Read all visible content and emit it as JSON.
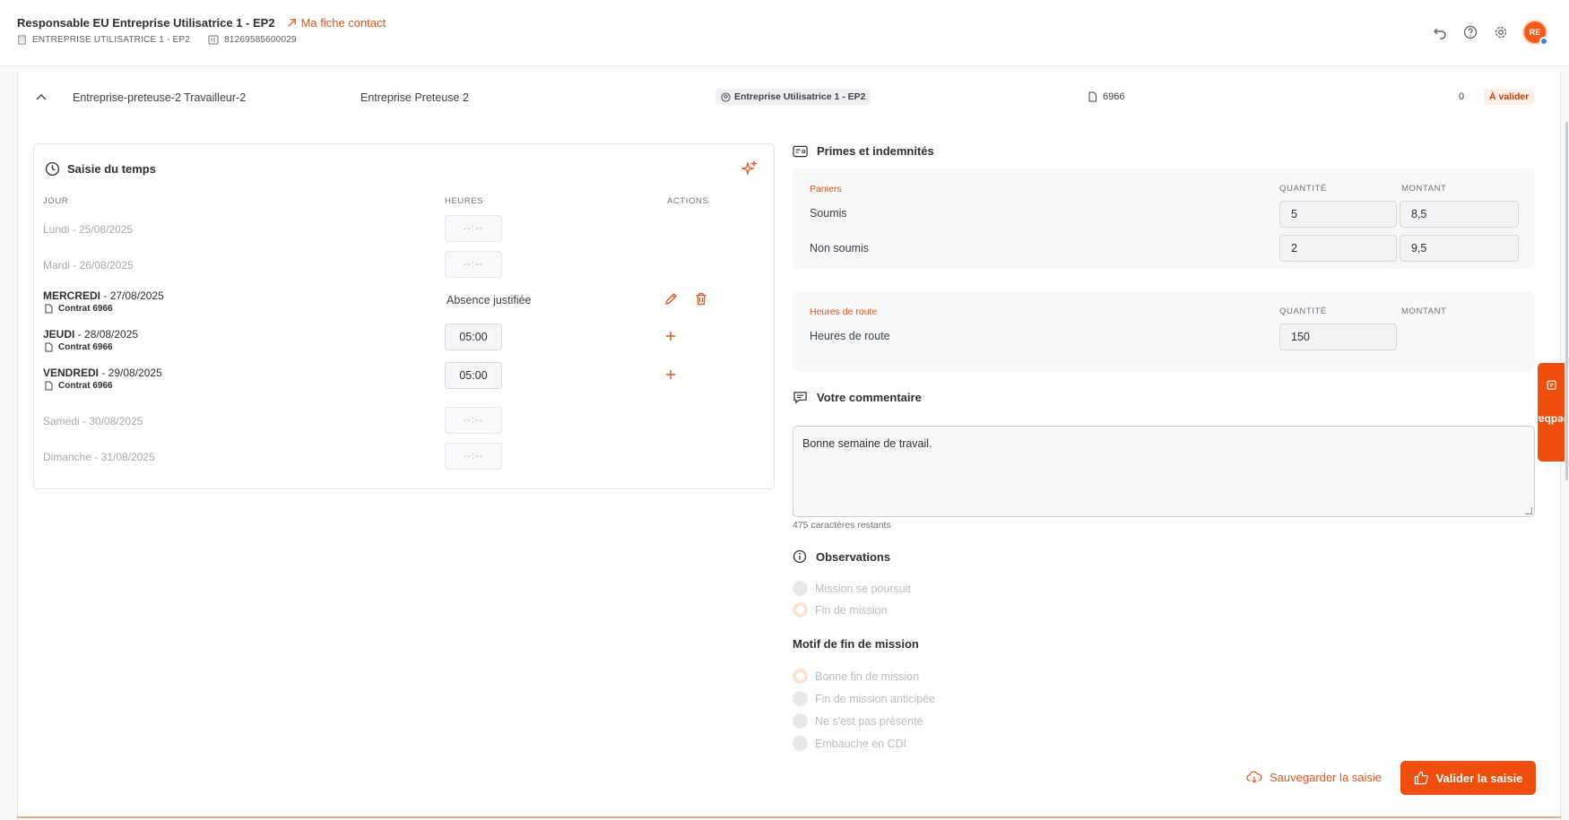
{
  "header": {
    "title": "Responsable EU Entreprise Utilisatrice 1 - EP2",
    "contact_link": "Ma fiche contact",
    "company": "ENTREPRISE UTILISATRICE 1 - EP2",
    "siret": "81269585600029",
    "avatar_initials": "RE"
  },
  "row": {
    "worker": "Entreprise-preteuse-2 Travailleur-2",
    "lender": "Entreprise Preteuse 2",
    "client_badge": "Entreprise Utilisatrice 1 - EP2",
    "contract": "6966",
    "count": "0",
    "status": "À valider"
  },
  "time": {
    "title": "Saisie du temps",
    "col_day": "JOUR",
    "col_hours": "HEURES",
    "col_actions": "ACTIONS",
    "empty_hours": "--:--",
    "days": [
      {
        "name": "Lundi",
        "date": "- 25/08/2025"
      },
      {
        "name": "Mardi",
        "date": "- 26/08/2025"
      },
      {
        "name": "MERCREDI",
        "date": "- 27/08/2025",
        "contract": "Contrat 6966",
        "absence": "Absence justifiée"
      },
      {
        "name": "JEUDI",
        "date": "- 28/08/2025",
        "contract": "Contrat 6966",
        "hours": "05:00"
      },
      {
        "name": "VENDREDI",
        "date": "- 29/08/2025",
        "contract": "Contrat 6966",
        "hours": "05:00"
      },
      {
        "name": "Samedi",
        "date": "- 30/08/2025"
      },
      {
        "name": "Dimanche",
        "date": "- 31/08/2025"
      }
    ]
  },
  "primes": {
    "title": "Primes et indemnités",
    "col_qty": "QUANTITÉ",
    "col_amount": "MONTANT",
    "paniers": {
      "category": "Paniers",
      "rows": [
        {
          "label": "Soumis",
          "qty": "5",
          "amount": "8,5"
        },
        {
          "label": "Non soumis",
          "qty": "2",
          "amount": "9,5"
        }
      ]
    },
    "route": {
      "category": "Heures de route",
      "rows": [
        {
          "label": "Heures de route",
          "qty": "150"
        }
      ]
    }
  },
  "comment": {
    "title": "Votre commentaire",
    "value": "Bonne semaine de travail.",
    "remaining": "475 caractères restants"
  },
  "observations": {
    "title": "Observations",
    "options": [
      "Mission se poursuit",
      "Fin de mission"
    ],
    "selected": 1
  },
  "motif": {
    "title": "Motif de fin de mission",
    "options": [
      "Bonne fin de mission",
      "Fin de mission anticipée",
      "Ne s'est pas présenté",
      "Embauche en CDI"
    ],
    "selected": 0
  },
  "actions": {
    "save": "Sauvegarder la saisie",
    "validate": "Valider la saisie"
  },
  "feedback": "Feedback",
  "colors": {
    "accent": "#f04e0f",
    "accent_text": "#e2541b"
  }
}
